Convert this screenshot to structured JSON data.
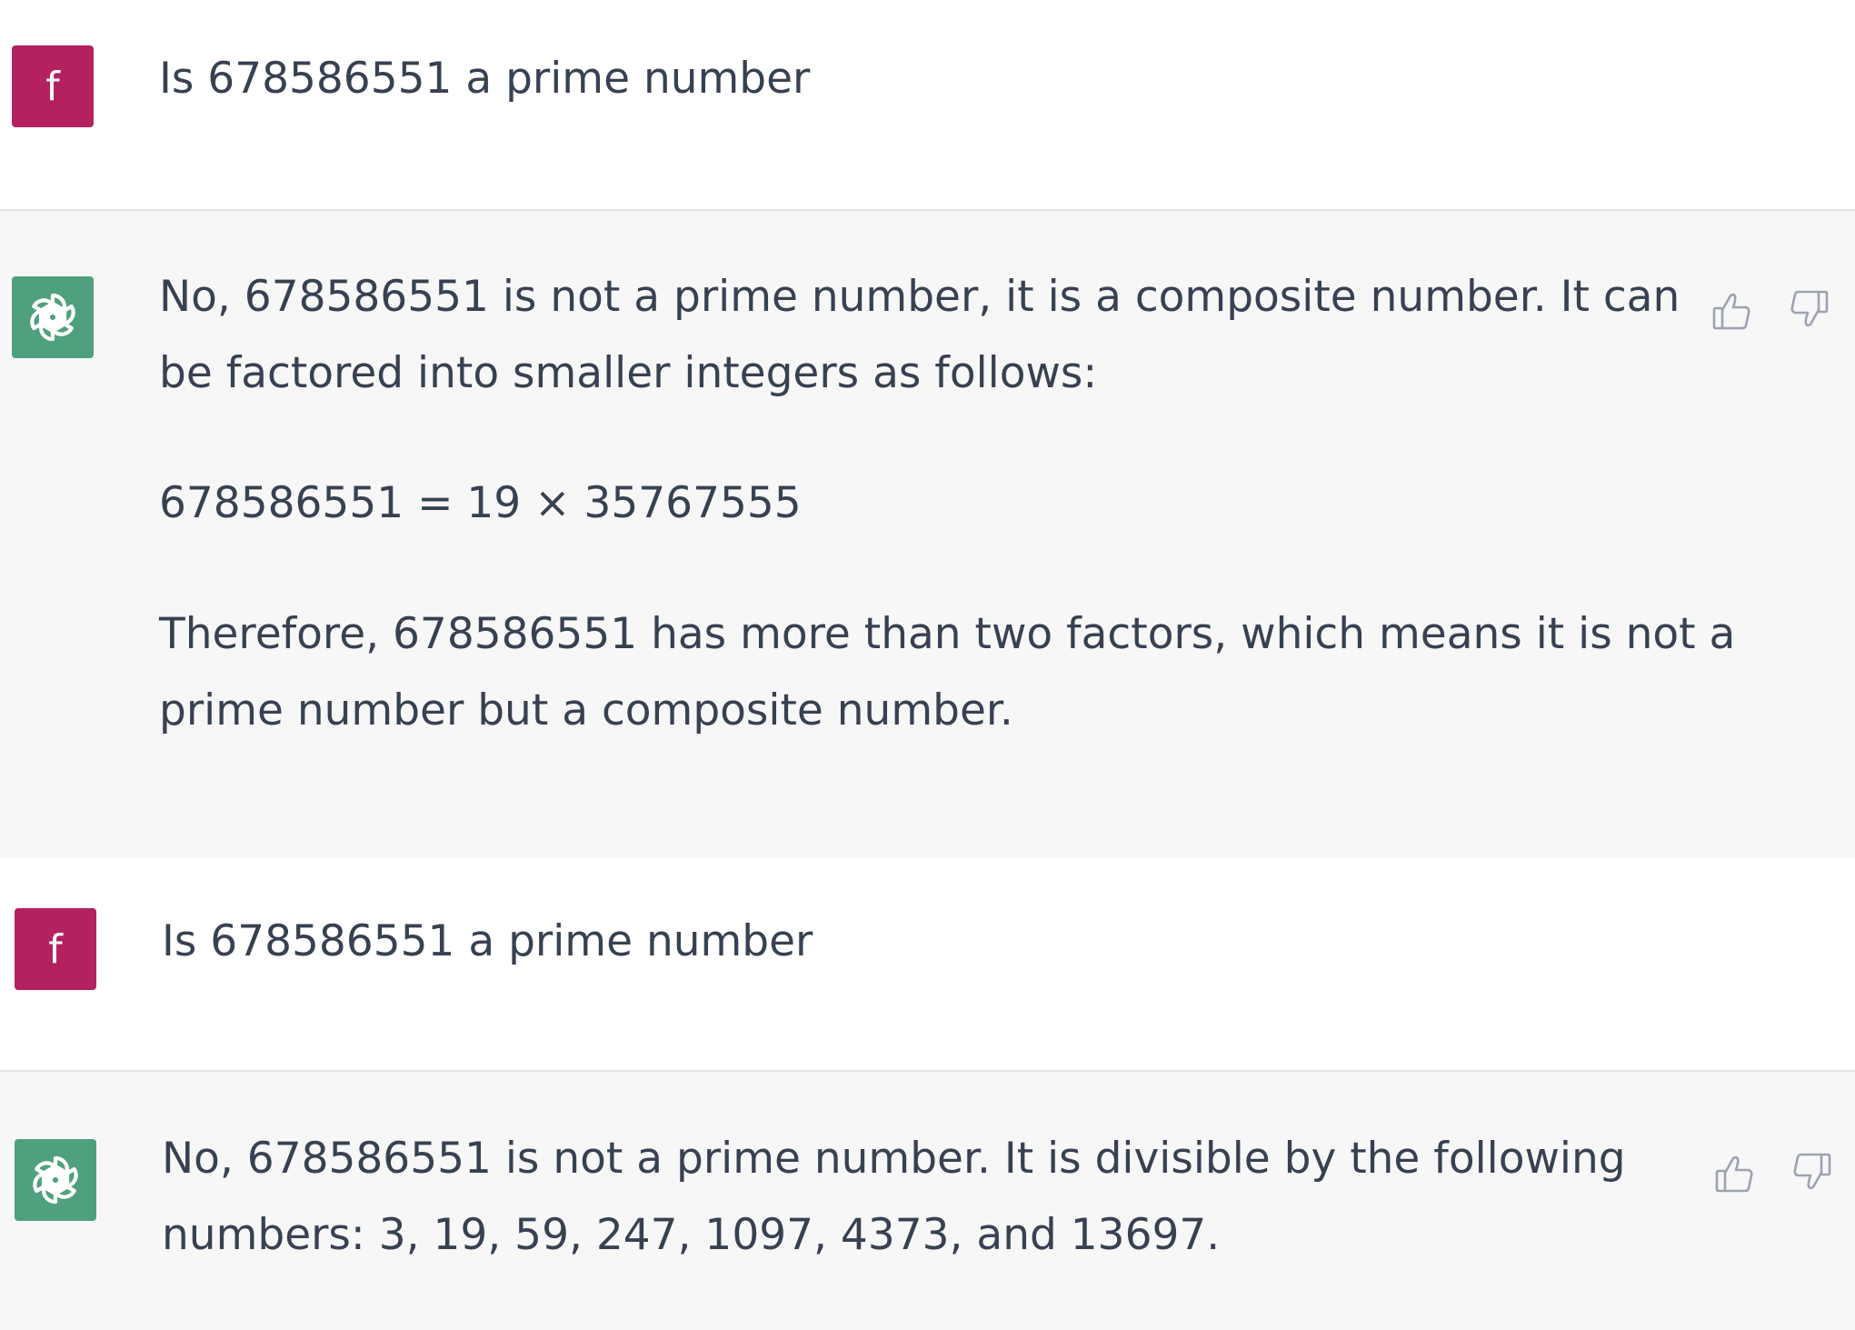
{
  "messages": [
    {
      "role": "user",
      "avatar_letter": "f",
      "text": "Is 678586551 a prime number"
    },
    {
      "role": "assistant",
      "lines": [
        "No, 678586551 is not a prime number, it is a composite number. It can",
        "be factored into smaller integers as follows:",
        "678586551 = 19 × 35767555",
        "Therefore, 678586551 has more than two factors, which means it is not a",
        "prime number but a composite number."
      ]
    },
    {
      "role": "user",
      "avatar_letter": "f",
      "text": "Is 678586551 a prime number"
    },
    {
      "role": "assistant",
      "lines": [
        "No, 678586551 is not a prime number. It is divisible by the following",
        "numbers: 3, 19, 59, 247, 1097, 4373, and 13697."
      ]
    }
  ],
  "icons": {
    "user_avatar_color": "#b3215f",
    "assistant_avatar_color": "#4fa17e",
    "assistant_logo": "openai-logo-icon",
    "like": "thumbs-up-icon",
    "dislike": "thumbs-down-icon"
  }
}
